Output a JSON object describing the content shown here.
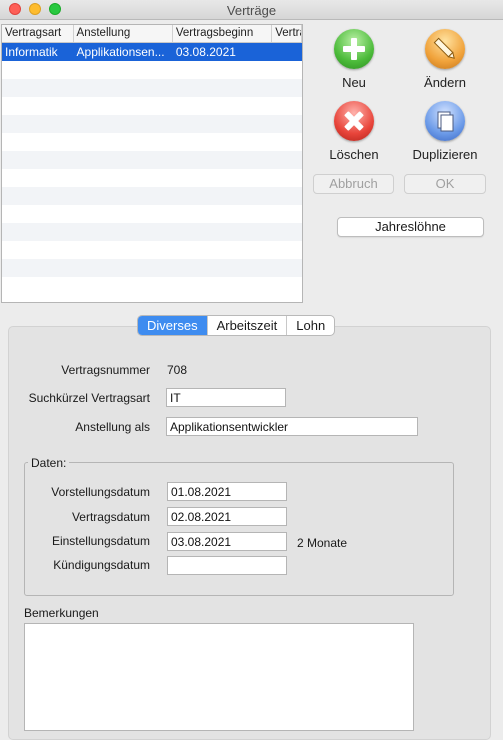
{
  "window": {
    "title": "Verträge"
  },
  "table": {
    "columns": [
      "Vertragsart",
      "Anstellung",
      "Vertragsbeginn",
      "Vertra"
    ],
    "rows": [
      {
        "vertragsart": "Informatik",
        "anstellung": "Applikationsen...",
        "vertragsbeginn": "03.08.2021",
        "vertra": ""
      }
    ]
  },
  "actions": {
    "new_label": "Neu",
    "edit_label": "Ändern",
    "delete_label": "Löschen",
    "duplicate_label": "Duplizieren",
    "cancel_label": "Abbruch",
    "ok_label": "OK",
    "annual_wages_label": "Jahreslöhne"
  },
  "tabs": [
    "Diverses",
    "Arbeitszeit",
    "Lohn"
  ],
  "form": {
    "contract_number_label": "Vertragsnummer",
    "contract_number": "708",
    "search_short_label": "Suchkürzel Vertragsart",
    "search_short_value": "IT",
    "employment_label": "Anstellung als",
    "employment_value": "Applikationsentwickler",
    "dates_group_label": "Daten:",
    "interview_date_label": "Vorstellungsdatum",
    "interview_date": "01.08.2021",
    "contract_date_label": "Vertragsdatum",
    "contract_date": "02.08.2021",
    "hire_date_label": "Einstellungsdatum",
    "hire_date": "03.08.2021",
    "hire_duration": "2 Monate",
    "termination_date_label": "Kündigungsdatum",
    "termination_date": "",
    "remarks_label": "Bemerkungen",
    "remarks": ""
  }
}
